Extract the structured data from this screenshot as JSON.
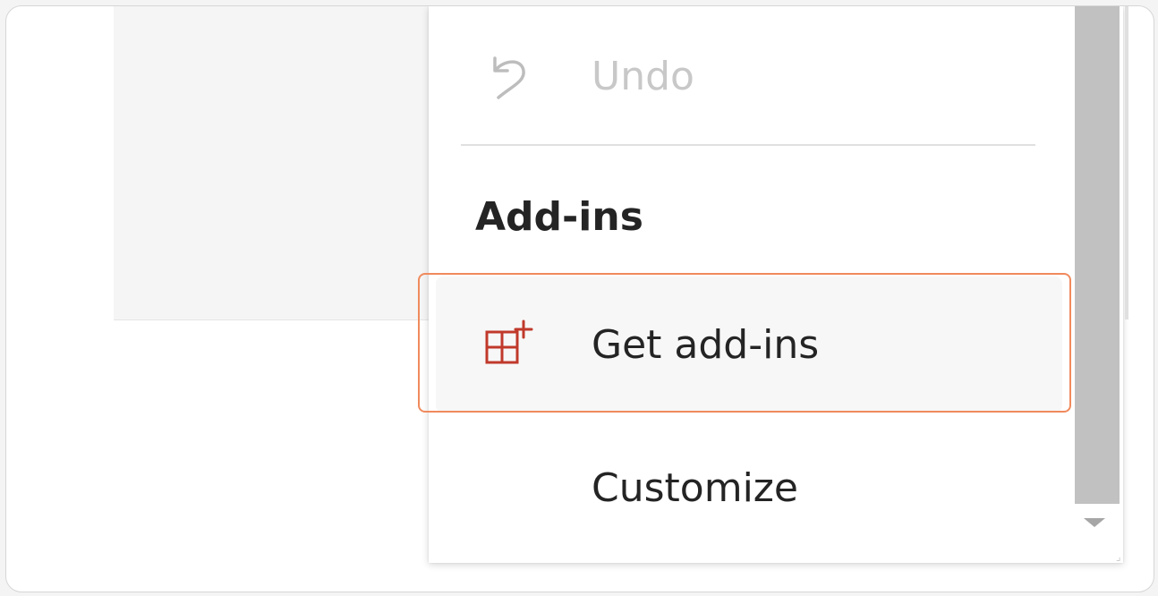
{
  "menu": {
    "undo": {
      "label": "Undo",
      "icon": "undo-icon",
      "disabled": true
    },
    "section": {
      "heading": "Add-ins"
    },
    "get_addins": {
      "label": "Get add-ins",
      "icon": "add-ins-grid-icon",
      "highlighted": true
    },
    "customize": {
      "label": "Customize"
    }
  },
  "colors": {
    "highlight_border": "#f08a5d",
    "icon_accent": "#c0392b",
    "disabled_text": "#c8c8c8",
    "scroll_thumb": "#c1c1c1"
  }
}
